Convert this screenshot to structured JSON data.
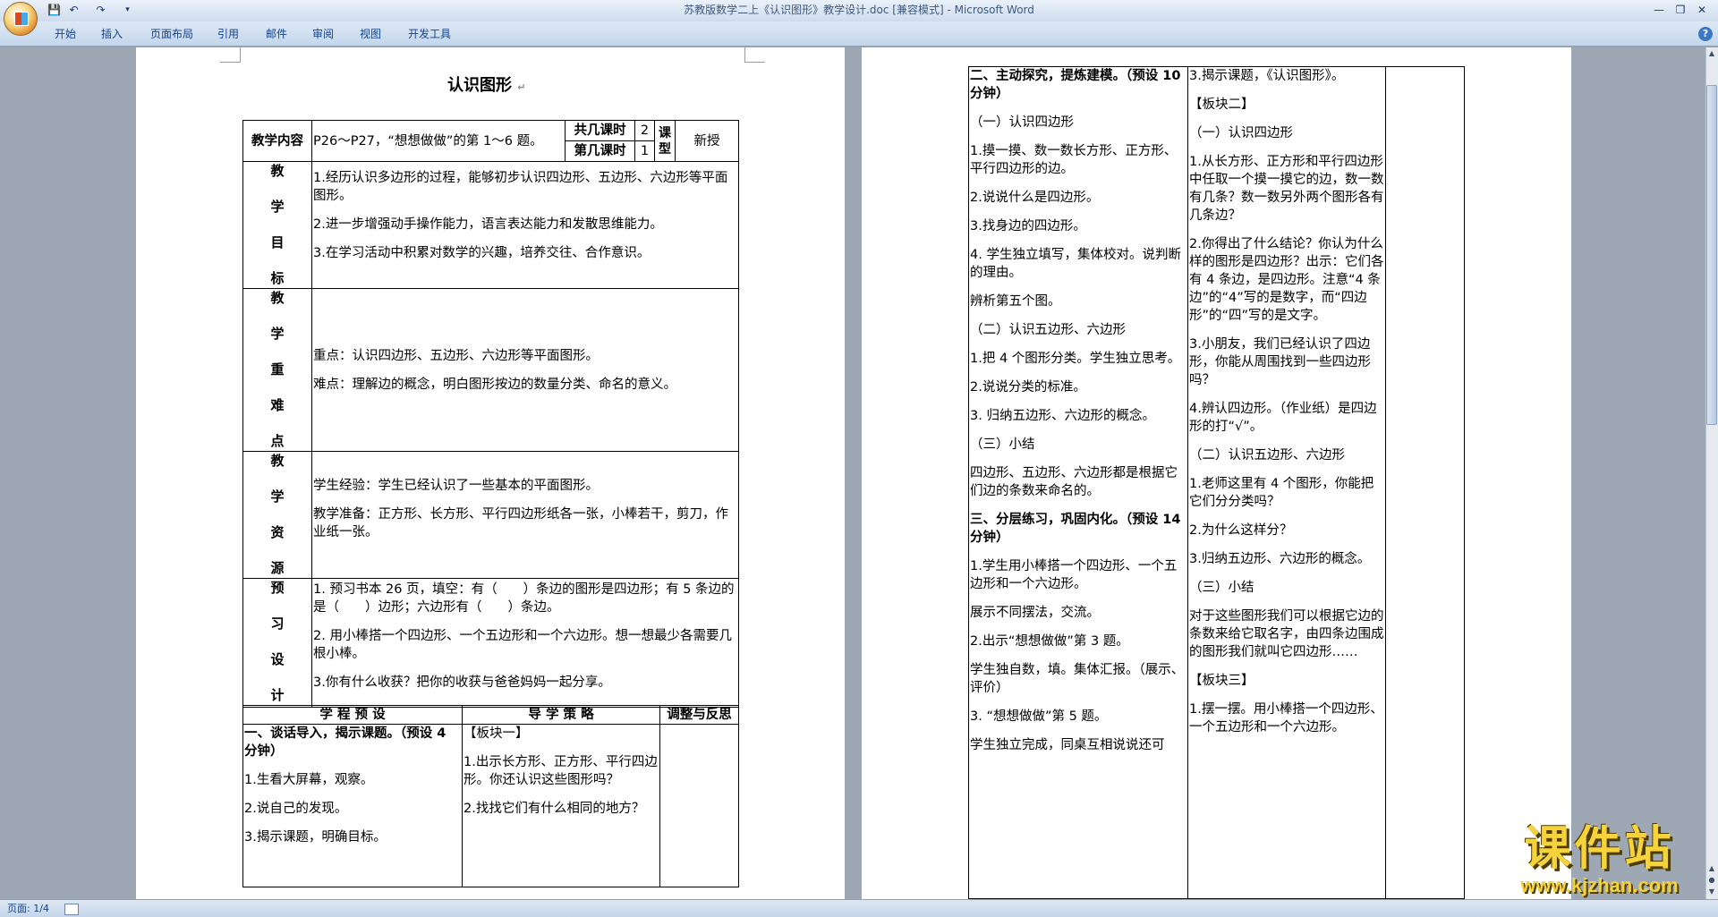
{
  "window": {
    "title": "苏教版数学二上《认识图形》教学设计.doc [兼容模式] - Microsoft Word",
    "title_color": "#3d5a7e"
  },
  "quick_access": [
    "save-icon",
    "undo-icon",
    "redo-icon",
    "customize-icon"
  ],
  "ribbon": {
    "tabs": [
      "开始",
      "插入",
      "页面布局",
      "引用",
      "邮件",
      "审阅",
      "视图",
      "开发工具"
    ],
    "accent": "#15428b"
  },
  "status": {
    "page": "页面: 1/4"
  },
  "page1": {
    "heading": "认识图形",
    "header_row": {
      "label": "教学内容",
      "content": "P26～P27，“想想做做”的第 1～6 题。",
      "total_label": "共几课时",
      "total_value": "2",
      "nth_label": "第几课时",
      "nth_value": "1",
      "type_label": "课型",
      "type_value": "新授"
    },
    "objectives": {
      "label": [
        "教",
        "学",
        "目",
        "标"
      ],
      "items": [
        "1.经历认识多边形的过程，能够初步认识四边形、五边形、六边形等平面图形。",
        "2.进一步增强动手操作能力，语言表达能力和发散思维能力。",
        "3.在学习活动中积累对数学的兴趣，培养交往、合作意识。"
      ]
    },
    "key_points": {
      "label": [
        "教",
        "学",
        "重",
        "难",
        "点"
      ],
      "items": [
        "重点：认识四边形、五边形、六边形等平面图形。",
        "难点：理解边的概念，明白图形按边的数量分类、命名的意义。"
      ]
    },
    "resources": {
      "label": [
        "教",
        "学",
        "资",
        "源"
      ],
      "items": [
        "学生经验：学生已经认识了一些基本的平面图形。",
        "教学准备：正方形、长方形、平行四边形纸各一张，小棒若干，剪刀，作业纸一张。"
      ]
    },
    "preview": {
      "label": [
        "预",
        "习",
        "设",
        "计"
      ],
      "items": [
        "1. 预习书本 26 页，填空：有（　　）条边的图形是四边形；有 5 条边的是（　　）边形；六边形有（　　）条边。",
        "2. 用小棒搭一个四边形、一个五边形和一个六边形。想一想最少各需要几根小棒。",
        "3.你有什么收获？把你的收获与爸爸妈妈一起分享。"
      ]
    },
    "columns": [
      "学 程 预 设",
      "导 学 策 略",
      "调整与反思"
    ],
    "section1": {
      "title": "一、谈话导入，揭示课题。（预设 4 分钟）",
      "items": [
        "1.生看大屏幕，观察。",
        "2.说自己的发现。",
        "3.揭示课题，明确目标。"
      ]
    },
    "strategy1": {
      "title": "【板块一】",
      "items": [
        "1.出示长方形、正方形、平行四边形。你还认识这些图形吗？",
        "2.找找它们有什么相同的地方？"
      ]
    }
  },
  "page2": {
    "left": [
      {
        "text": "二、主动探究，提炼建模。（预设 10 分钟）",
        "bold": true
      },
      {
        "text": "（一）认识四边形"
      },
      {
        "text": "1.摸一摸、数一数长方形、正方形、平行四边形的边。"
      },
      {
        "text": "2.说说什么是四边形。"
      },
      {
        "text": "3.找身边的四边形。"
      },
      {
        "text": "4. 学生独立填写，集体校对。说判断的理由。"
      },
      {
        "text": "辨析第五个图。"
      },
      {
        "text": "（二）认识五边形、六边形"
      },
      {
        "text": "1.把 4 个图形分类。学生独立思考。"
      },
      {
        "text": "2.说说分类的标准。"
      },
      {
        "text": "3. 归纳五边形、六边形的概念。"
      },
      {
        "text": "（三）小结"
      },
      {
        "text": "四边形、五边形、六边形都是根据它们边的条数来命名的。"
      },
      {
        "text": "三、分层练习，巩固内化。（预设 14 分钟）",
        "bold": true
      },
      {
        "text": "1.学生用小棒搭一个四边形、一个五边形和一个六边形。"
      },
      {
        "text": "展示不同摆法，交流。"
      },
      {
        "text": "2.出示“想想做做”第 3 题。"
      },
      {
        "text": "学生独自数，填。集体汇报。（展示、评价）"
      },
      {
        "text": "3. “想想做做”第 5 题。"
      },
      {
        "text": "学生独立完成，同桌互相说说还可"
      }
    ],
    "middle": [
      {
        "text": "3.揭示课题，《认识图形》。"
      },
      {
        "text": "【板块二】"
      },
      {
        "text": "（一）认识四边形"
      },
      {
        "text": "1.从长方形、正方形和平行四边形中任取一个摸一摸它的边，数一数有几条？数一数另外两个图形各有几条边？"
      },
      {
        "text": "2.你得出了什么结论？你认为什么样的图形是四边形？出示：它们各有 4 条边，是四边形。注意“4 条边”的“4”写的是数字，而“四边形”的“四”写的是文字。"
      },
      {
        "text": "3.小朋友，我们已经认识了四边形，你能从周围找到一些四边形吗？"
      },
      {
        "text": "4.辨认四边形。（作业纸）是四边形的打“√”。"
      },
      {
        "text": "（二）认识五边形、六边形"
      },
      {
        "text": "1.老师这里有 4 个图形，你能把它们分分类吗？"
      },
      {
        "text": "2.为什么这样分？"
      },
      {
        "text": "3.归纳五边形、六边形的概念。"
      },
      {
        "text": "（三）小结"
      },
      {
        "text": "对于这些图形我们可以根据它边的条数来给它取名字，由四条边围成的图形我们就叫它四边形……"
      },
      {
        "text": "【板块三】"
      },
      {
        "text": "1.摆一摆。用小棒搭一个四边形、一个五边形和一个六边形。"
      }
    ]
  },
  "watermark": {
    "logo": "课件站",
    "url": "www.kjzhan.com",
    "color": "#f6d33b"
  }
}
